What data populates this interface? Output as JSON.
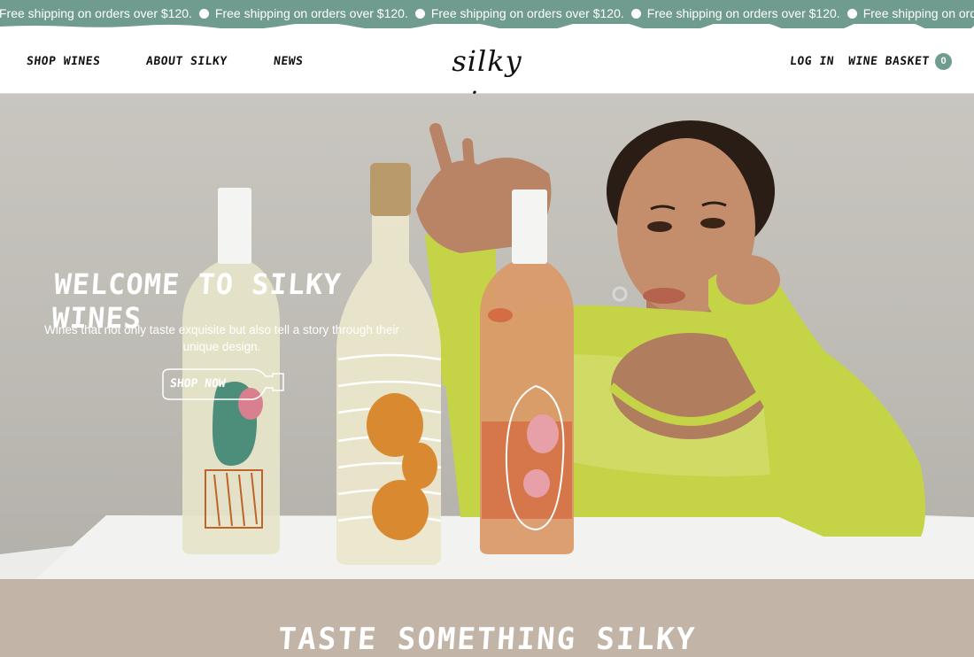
{
  "announcement": {
    "message": "Free shipping on orders over $120.",
    "repeat_count": 5,
    "background": "#6f9c8e"
  },
  "header": {
    "nav_left": [
      {
        "label": "SHOP WINES"
      },
      {
        "label": "ABOUT SILKY"
      },
      {
        "label": "NEWS"
      }
    ],
    "logo": "silky wines",
    "login_label": "LOG IN",
    "basket_label": "WINE BASKET",
    "basket_count": "0"
  },
  "hero": {
    "title": "WELCOME TO SILKY WINES",
    "subtitle": "Wines that not only taste exquisite but also tell a story through their unique design.",
    "cta_label": "SHOP NOW"
  },
  "section": {
    "title": "TASTE SOMETHING SILKY"
  },
  "colors": {
    "accent": "#6f9c8e",
    "band": "#c2b4a6",
    "sweater": "#c3d34a"
  }
}
